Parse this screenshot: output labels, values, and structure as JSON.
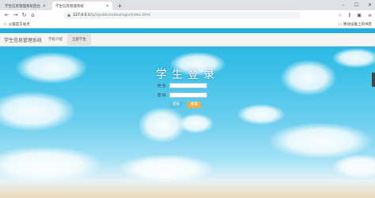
{
  "browser": {
    "tabs": [
      {
        "label": "学生信息管理系统后台",
        "active": false
      },
      {
        "label": "学生信息管理系统",
        "active": true
      }
    ],
    "url": {
      "host": "127.0.0.1",
      "path": "/tp5/public/index/login/index.html"
    },
    "bookmarks": {
      "left": "火狐官方站点",
      "right": "移动设备上的书签"
    }
  },
  "site": {
    "brand": "学生信息管理系统",
    "nav": [
      {
        "label": "学校介绍"
      },
      {
        "label": "全部学生",
        "active": true
      }
    ]
  },
  "login": {
    "title": "学生登录",
    "username_label": "姓 名:",
    "username_value": "",
    "password_label": "密 码:",
    "password_value": "",
    "login_button": "登录",
    "reset_button": "重置"
  },
  "colors": {
    "header_strip": "#1fb0de",
    "login_button": "#5bc0de",
    "reset_button": "#f0ad4e"
  },
  "icons": [
    "close-icon",
    "new-tab-icon",
    "back-icon",
    "forward-icon",
    "reload-icon",
    "home-icon",
    "globe-icon",
    "bookmark-star-icon",
    "folder-icon"
  ]
}
